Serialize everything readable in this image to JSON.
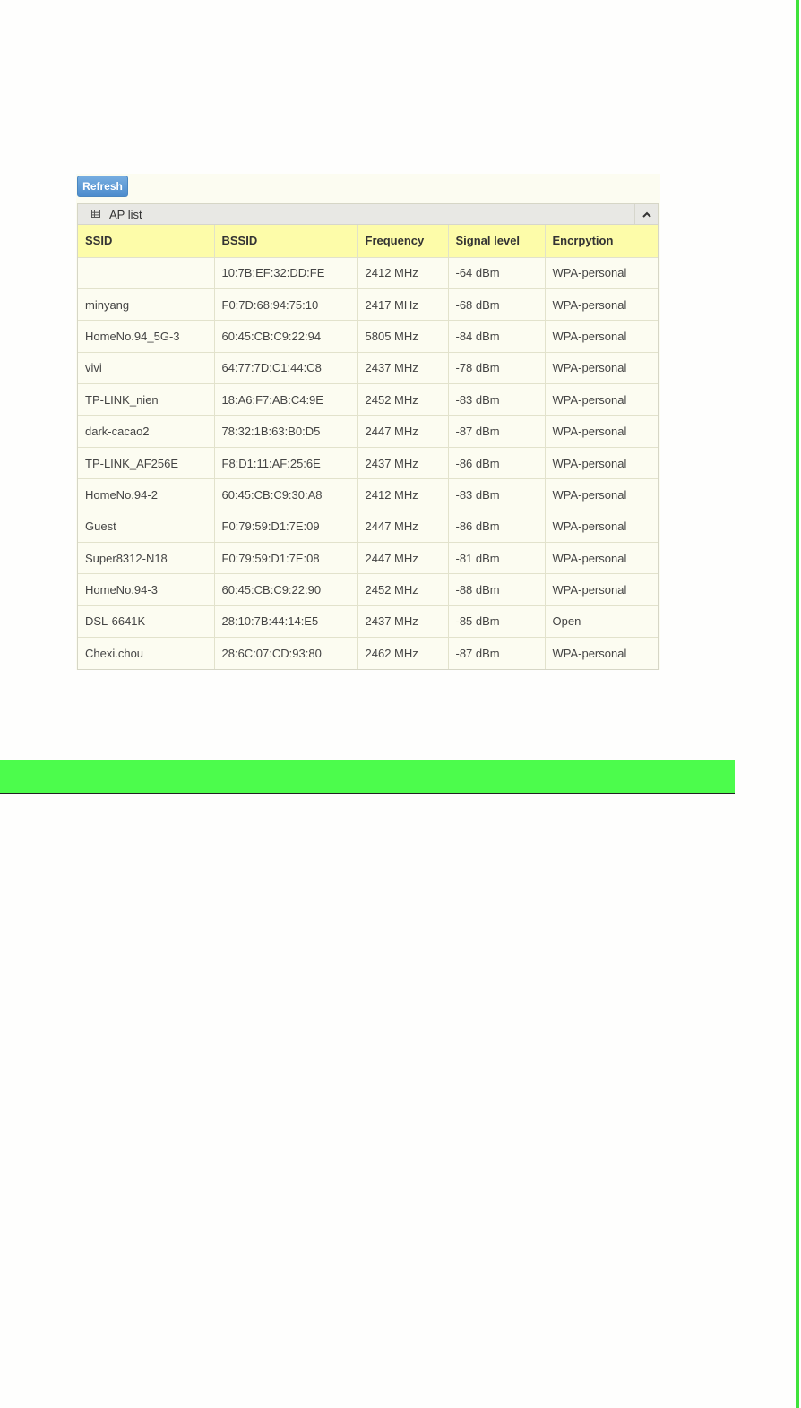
{
  "toolbar": {
    "refresh_label": "Refresh"
  },
  "ap_list": {
    "title": "AP list",
    "columns": [
      "SSID",
      "BSSID",
      "Frequency",
      "Signal level",
      "Encrpytion"
    ],
    "rows": [
      [
        "",
        "10:7B:EF:32:DD:FE",
        "2412 MHz",
        "-64 dBm",
        "WPA-personal"
      ],
      [
        "minyang",
        "F0:7D:68:94:75:10",
        "2417 MHz",
        "-68 dBm",
        "WPA-personal"
      ],
      [
        "HomeNo.94_5G-3",
        "60:45:CB:C9:22:94",
        "5805 MHz",
        "-84 dBm",
        "WPA-personal"
      ],
      [
        "vivi",
        "64:77:7D:C1:44:C8",
        "2437 MHz",
        "-78 dBm",
        "WPA-personal"
      ],
      [
        "TP-LINK_nien",
        "18:A6:F7:AB:C4:9E",
        "2452 MHz",
        "-83 dBm",
        "WPA-personal"
      ],
      [
        "dark-cacao2",
        "78:32:1B:63:B0:D5",
        "2447 MHz",
        "-87 dBm",
        "WPA-personal"
      ],
      [
        "TP-LINK_AF256E",
        "F8:D1:11:AF:25:6E",
        "2437 MHz",
        "-86 dBm",
        "WPA-personal"
      ],
      [
        "HomeNo.94-2",
        "60:45:CB:C9:30:A8",
        "2412 MHz",
        "-83 dBm",
        "WPA-personal"
      ],
      [
        "Guest",
        "F0:79:59:D1:7E:09",
        "2447 MHz",
        "-86 dBm",
        "WPA-personal"
      ],
      [
        "Super8312-N18",
        "F0:79:59:D1:7E:08",
        "2447 MHz",
        "-81 dBm",
        "WPA-personal"
      ],
      [
        "HomeNo.94-3",
        "60:45:CB:C9:22:90",
        "2452 MHz",
        "-88 dBm",
        "WPA-personal"
      ],
      [
        "DSL-6641K",
        "28:10:7B:44:14:E5",
        "2437 MHz",
        "-85 dBm",
        "Open"
      ],
      [
        "Chexi.chou",
        "28:6C:07:CD:93:80",
        "2462 MHz",
        "-87 dBm",
        "WPA-personal"
      ]
    ]
  },
  "icons": {
    "table": "table-icon",
    "collapse": "chevron-up-icon"
  },
  "colors": {
    "accent_green": "#4cfc4c",
    "header_yellow": "#fdfca9",
    "button_blue": "#5b9bd5"
  }
}
